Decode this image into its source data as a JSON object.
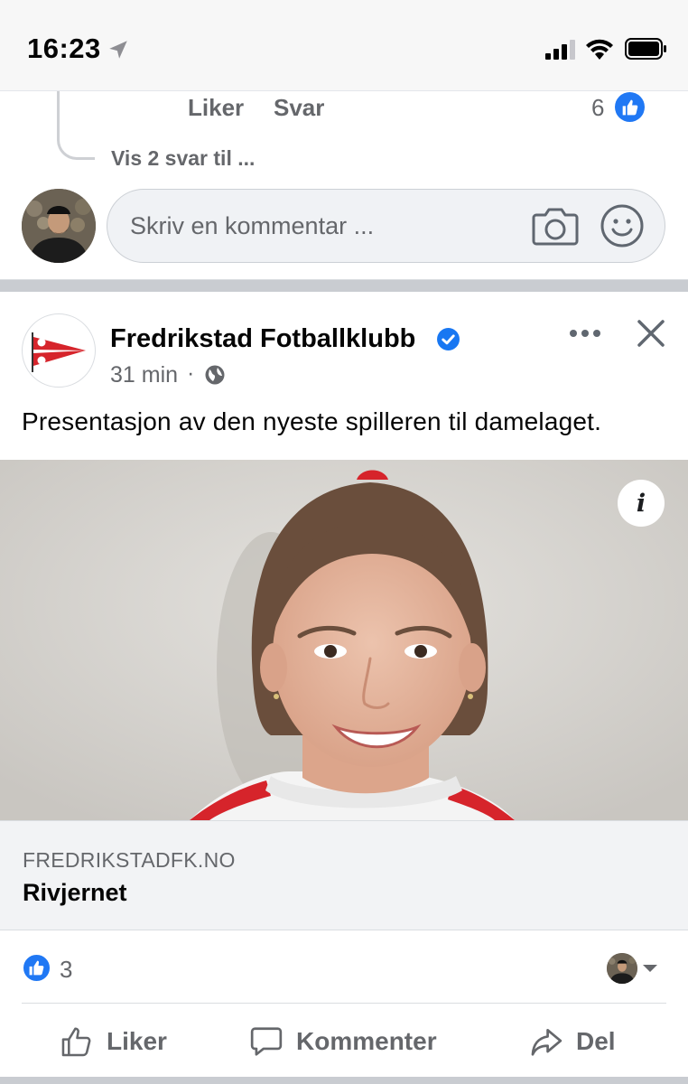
{
  "status_bar": {
    "time": "16:23"
  },
  "comment": {
    "like_label": "Liker",
    "reply_label": "Svar",
    "like_count": "6",
    "view_replies": "Vis 2 svar til ..."
  },
  "composer": {
    "placeholder": "Skriv en kommentar ..."
  },
  "post": {
    "page_name": "Fredrikstad Fotballklubb",
    "time": "31 min",
    "separator": "·",
    "text": "Presentasjon av den nyeste spilleren til damelaget.",
    "info_glyph": "i",
    "link": {
      "domain": "FREDRIKSTADFK.NO",
      "title": "Rivjernet"
    },
    "reaction_count": "3",
    "actions": {
      "like": "Liker",
      "comment": "Kommenter",
      "share": "Del"
    }
  },
  "colors": {
    "facebook_blue": "#2078f4",
    "secondary_text": "#65676b",
    "club_red": "#d6242b"
  },
  "icons": [
    "location-arrow-icon",
    "signal-icon",
    "wifi-icon",
    "battery-icon",
    "thumbs-up-icon",
    "camera-icon",
    "smile-icon",
    "verified-badge-icon",
    "globe-icon",
    "more-icon",
    "close-icon",
    "info-icon",
    "caret-down-icon",
    "comment-bubble-icon",
    "share-arrow-icon"
  ]
}
